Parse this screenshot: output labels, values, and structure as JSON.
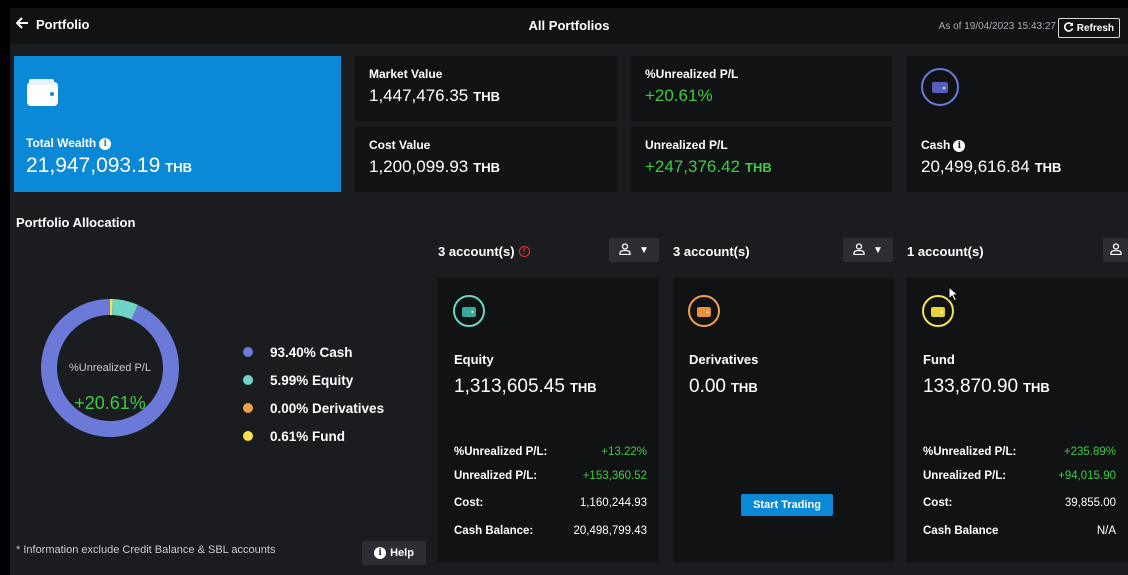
{
  "header": {
    "back_label": "Portfolio",
    "title": "All Portfolios",
    "as_of": "As of 19/04/2023 15:43:27",
    "refresh_label": "Refresh"
  },
  "summary": {
    "total_wealth": {
      "label": "Total Wealth",
      "value": "21,947,093.19",
      "unit": "THB"
    },
    "market_value": {
      "label": "Market Value",
      "value": "1,447,476.35",
      "unit": "THB"
    },
    "cost_value": {
      "label": "Cost Value",
      "value": "1,200,099.93",
      "unit": "THB"
    },
    "unrealized_pct": {
      "label": "%Unrealized P/L",
      "value": "+20.61%"
    },
    "unrealized_pl": {
      "label": "Unrealized P/L",
      "value": "+247,376.42",
      "unit": "THB"
    },
    "cash": {
      "label": "Cash",
      "value": "20,499,616.84",
      "unit": "THB"
    }
  },
  "allocation": {
    "title": "Portfolio Allocation",
    "center_label": "%Unrealized P/L",
    "center_value": "+20.61%",
    "items": [
      {
        "percent": 93.4,
        "text": "93.40% Cash",
        "color": "#6b7ad8"
      },
      {
        "percent": 5.99,
        "text": "5.99% Equity",
        "color": "#6fd3c5"
      },
      {
        "percent": 0.0,
        "text": "0.00% Derivatives",
        "color": "#f0a04b"
      },
      {
        "percent": 0.61,
        "text": "0.61% Fund",
        "color": "#f5e251"
      }
    ],
    "note": "* Information exclude Credit Balance & SBL accounts",
    "help_label": "Help"
  },
  "accounts": [
    {
      "count_label": "3 account(s)",
      "name": "Equity",
      "amount": "1,313,605.45",
      "unit": "THB",
      "icon": "wallet-icon",
      "icon_color": "#6fd3c5",
      "stats": [
        {
          "key": "%Unrealized P/L:",
          "value": "+13.22%",
          "positive": true
        },
        {
          "key": "Unrealized P/L:",
          "value": "+153,360.52",
          "positive": true
        },
        {
          "key": "Cost:",
          "value": "1,160,244.93",
          "positive": false
        },
        {
          "key": "Cash Balance:",
          "value": "20,498,799.43",
          "positive": false
        }
      ]
    },
    {
      "count_label": "3 account(s)",
      "name": "Derivatives",
      "amount": "0.00",
      "unit": "THB",
      "icon": "wallet-icon",
      "icon_color": "#f0a04b",
      "action_label": "Start Trading"
    },
    {
      "count_label": "1 account(s)",
      "name": "Fund",
      "amount": "133,870.90",
      "unit": "THB",
      "icon": "wallet-icon",
      "icon_color": "#f5e251",
      "stats": [
        {
          "key": "%Unrealized P/L:",
          "value": "+235.89%",
          "positive": true
        },
        {
          "key": "Unrealized P/L:",
          "value": "+94,015.90",
          "positive": true
        },
        {
          "key": "Cost:",
          "value": "39,855.00",
          "positive": false
        },
        {
          "key": "Cash Balance",
          "value": "N/A",
          "positive": false
        }
      ]
    }
  ]
}
